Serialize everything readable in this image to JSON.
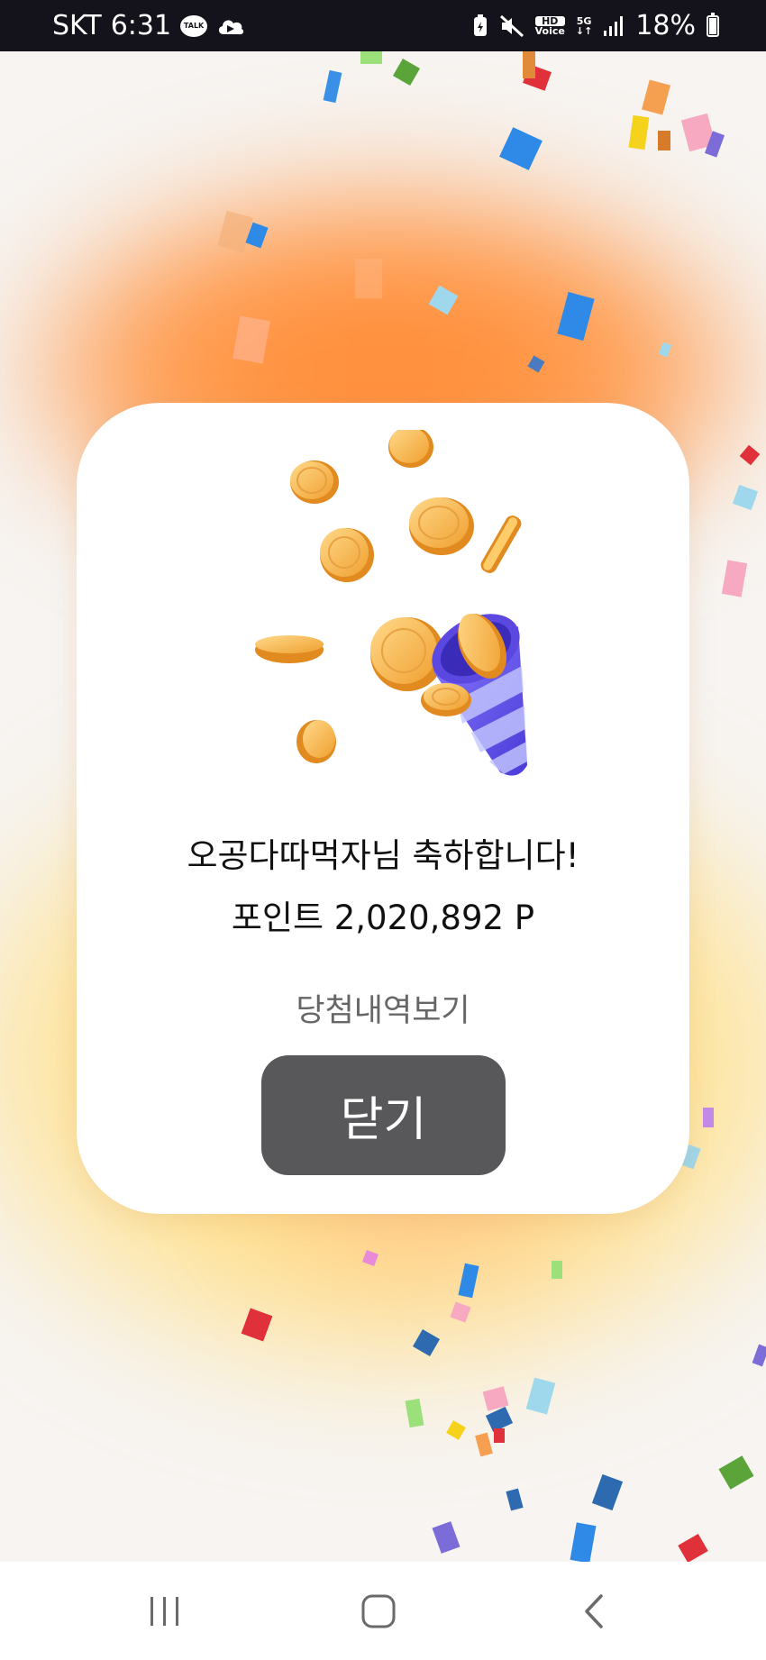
{
  "status_bar": {
    "carrier": "SKT",
    "time": "6:31",
    "talk_badge": "TALK",
    "hd_badge_top": "HD",
    "hd_badge_bottom": "Voice",
    "network": "5G",
    "battery_percent": "18%",
    "battery_level": 0.18
  },
  "modal": {
    "congrats_message": "오공다따먹자님 축하합니다!",
    "points_text": "포인트 2,020,892 P",
    "win_history_link": "당첨내역보기",
    "close_button": "닫기"
  },
  "navigation": {
    "recent_apps_icon": "recent-apps-icon",
    "home_icon": "home-icon",
    "back_icon": "back-icon"
  },
  "colors": {
    "status_bar_bg": "#14131b",
    "close_button_bg": "#58575a",
    "glow_orange": "#ff8a34",
    "glow_yellow": "#ffd66e",
    "coin_gold": "#f4a53a",
    "cone_purple": "#6a5cf0"
  }
}
